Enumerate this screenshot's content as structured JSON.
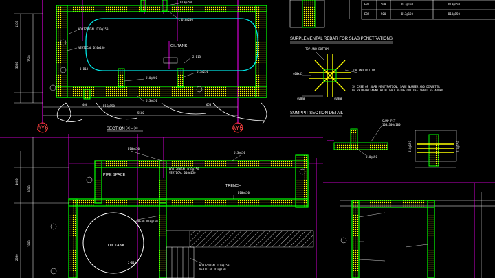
{
  "drawing": {
    "grid_labels": {
      "left": "AY6",
      "right": "AY5"
    },
    "section_title": "SECTION ⓐ - ⓐ",
    "upper_section": {
      "tank_label": "OIL TANK",
      "bar_labels": [
        "HORIZONTAL D10@150",
        "VERTICAL D10@150",
        "D10@250",
        "D16@200",
        "2-D13",
        "D13@250",
        "D10@200",
        "D13@150",
        "3-D13",
        "D16@150"
      ],
      "dims": [
        "2550",
        "3650",
        "2450",
        "1350",
        "350",
        "150",
        "400",
        "650",
        "5500"
      ]
    },
    "schedule_table": {
      "rows": [
        {
          "mark": "EB1",
          "size": "500",
          "bottom": "D13@150",
          "top": "D13@150"
        },
        {
          "mark": "EB2",
          "size": "500",
          "bottom": "D13@150",
          "top": "D13@150"
        }
      ]
    },
    "supplemental": {
      "title": "SUPPLEMENTAL REBAR FOR SLAB PENETRATIONS",
      "labels": [
        "TOP AND BOTTOM",
        "TOP AND BOTTOM",
        "400x45",
        "400mm",
        "400mm"
      ],
      "note_line1": "IN CASE OF SLAB PENETRATION, SAME NUMBER AND DIAMETER",
      "note_line2": "OF REINFORCEMENT WITH THAT BEING CUT OFF SHALL BE ADDED"
    },
    "sumppit": {
      "title": "SUMPPIT SECTION DETAIL",
      "labels": [
        "SUMP PIT",
        "100x100x100",
        "D10@150",
        "D10@150",
        "D10@150"
      ]
    },
    "plan": {
      "labels": {
        "pipe_space": "PIPE SPACE",
        "trench": "TRENCH",
        "oil_tank": "OIL TANK"
      },
      "bar_labels": [
        "HORIZONTAL D10@150",
        "VERTICAL D10@150",
        "D10@150",
        "D13@150",
        "SPREAD D10@150",
        "2-D13",
        "D10@150",
        "HORIZONTAL D10@150",
        "VERTICAL D10@150"
      ],
      "dims": [
        "4000",
        "2000",
        "1800",
        "1500",
        "2000"
      ]
    },
    "colors": {
      "background": "#000000",
      "wall": "#00ff00",
      "rebar": "#ffff00",
      "grid": "#ff00ff",
      "dim": "#ffffff",
      "bubble": "#ff3333",
      "hatch": "#bbbbbb"
    }
  }
}
